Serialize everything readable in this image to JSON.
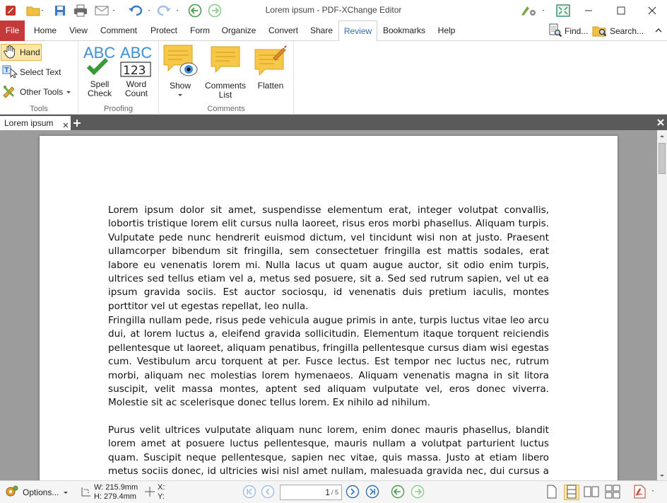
{
  "app": {
    "title": "Lorem ipsum - PDF-XChange Editor"
  },
  "menu": {
    "file": "File",
    "tabs": [
      {
        "label": "Home"
      },
      {
        "label": "View"
      },
      {
        "label": "Comment"
      },
      {
        "label": "Protect"
      },
      {
        "label": "Form"
      },
      {
        "label": "Organize"
      },
      {
        "label": "Convert"
      },
      {
        "label": "Share"
      },
      {
        "label": "Review",
        "active": true
      },
      {
        "label": "Bookmarks"
      },
      {
        "label": "Help"
      }
    ],
    "find": "Find...",
    "search": "Search..."
  },
  "ribbon": {
    "tools": {
      "group_label": "Tools",
      "hand": "Hand",
      "select_text": "Select Text",
      "other_tools": "Other Tools"
    },
    "proofing": {
      "group_label": "Proofing",
      "spell_check": "Spell\nCheck",
      "word_count": "Word\nCount",
      "abc_text": "ABC",
      "num_text": "123"
    },
    "comments": {
      "group_label": "Comments",
      "show": "Show",
      "comments_list": "Comments\nList",
      "flatten": "Flatten"
    }
  },
  "document_tab": {
    "label": "Lorem ipsum"
  },
  "document": {
    "paragraphs": [
      "Lorem ipsum dolor sit amet, suspendisse elementum erat, integer volutpat convallis, lobortis tristique lorem elit cursus nulla laoreet, risus eros morbi phasellus. Aliquam turpis. Vulputate pede nunc hendrerit euismod dictum, vel tincidunt wisi non at justo. Praesent ullamcorper bibendum sit fringilla, sem consectetuer fringilla est mattis sodales, erat labore eu venenatis lorem mi. Nulla lacus ut quam augue auctor, sit odio enim turpis, ultrices sed tellus etiam vel a, metus sed posuere, sit a. Sed sed rutrum sapien, vel ut ea ipsum gravida sociis. Est auctor sociosqu, id venenatis duis pretium iaculis, montes porttitor vel ut egestas repellat, leo nulla.",
      "Fringilla nullam pede, risus pede vehicula augue primis in ante, turpis luctus vitae leo arcu dui, at lorem luctus a, eleifend gravida sollicitudin. Elementum itaque torquent reiciendis pellentesque ut laoreet, aliquam penatibus, fringilla pellentesque cursus diam wisi egestas cum. Vestibulum arcu torquent at per. Fusce lectus. Est tempor nec luctus nec, rutrum morbi, aliquam nec molestias lorem hymenaeos. Aliquam venenatis magna in sit litora suscipit, velit massa montes, aptent sed aliquam vulputate vel, eros donec viverra. Molestie sit ac scelerisque donec tellus lorem. Ex nihilo ad nihilum.",
      "Purus velit ultrices vulputate aliquam nunc lorem, enim donec mauris phasellus, blandit lorem amet at posuere luctus pellentesque, mauris nullam a volutpat parturient luctus quam. Suscipit neque pellentesque, sapien nec vitae, quis massa. Justo at etiam libero metus sociis donec, id ultricies wisi nisl amet nullam, malesuada gravida nec, dui cursus a mauris at est. Mattis viverra"
    ]
  },
  "status": {
    "options": "Options...",
    "width": "W: 215.9mm",
    "height": "H: 279.4mm",
    "x": "X:",
    "y": "Y:",
    "page_current": "1",
    "page_total": "/ 5"
  },
  "colors": {
    "accent": "#2f6db5",
    "file_tab": "#c5393a",
    "workspace": "#9c9c9c"
  }
}
